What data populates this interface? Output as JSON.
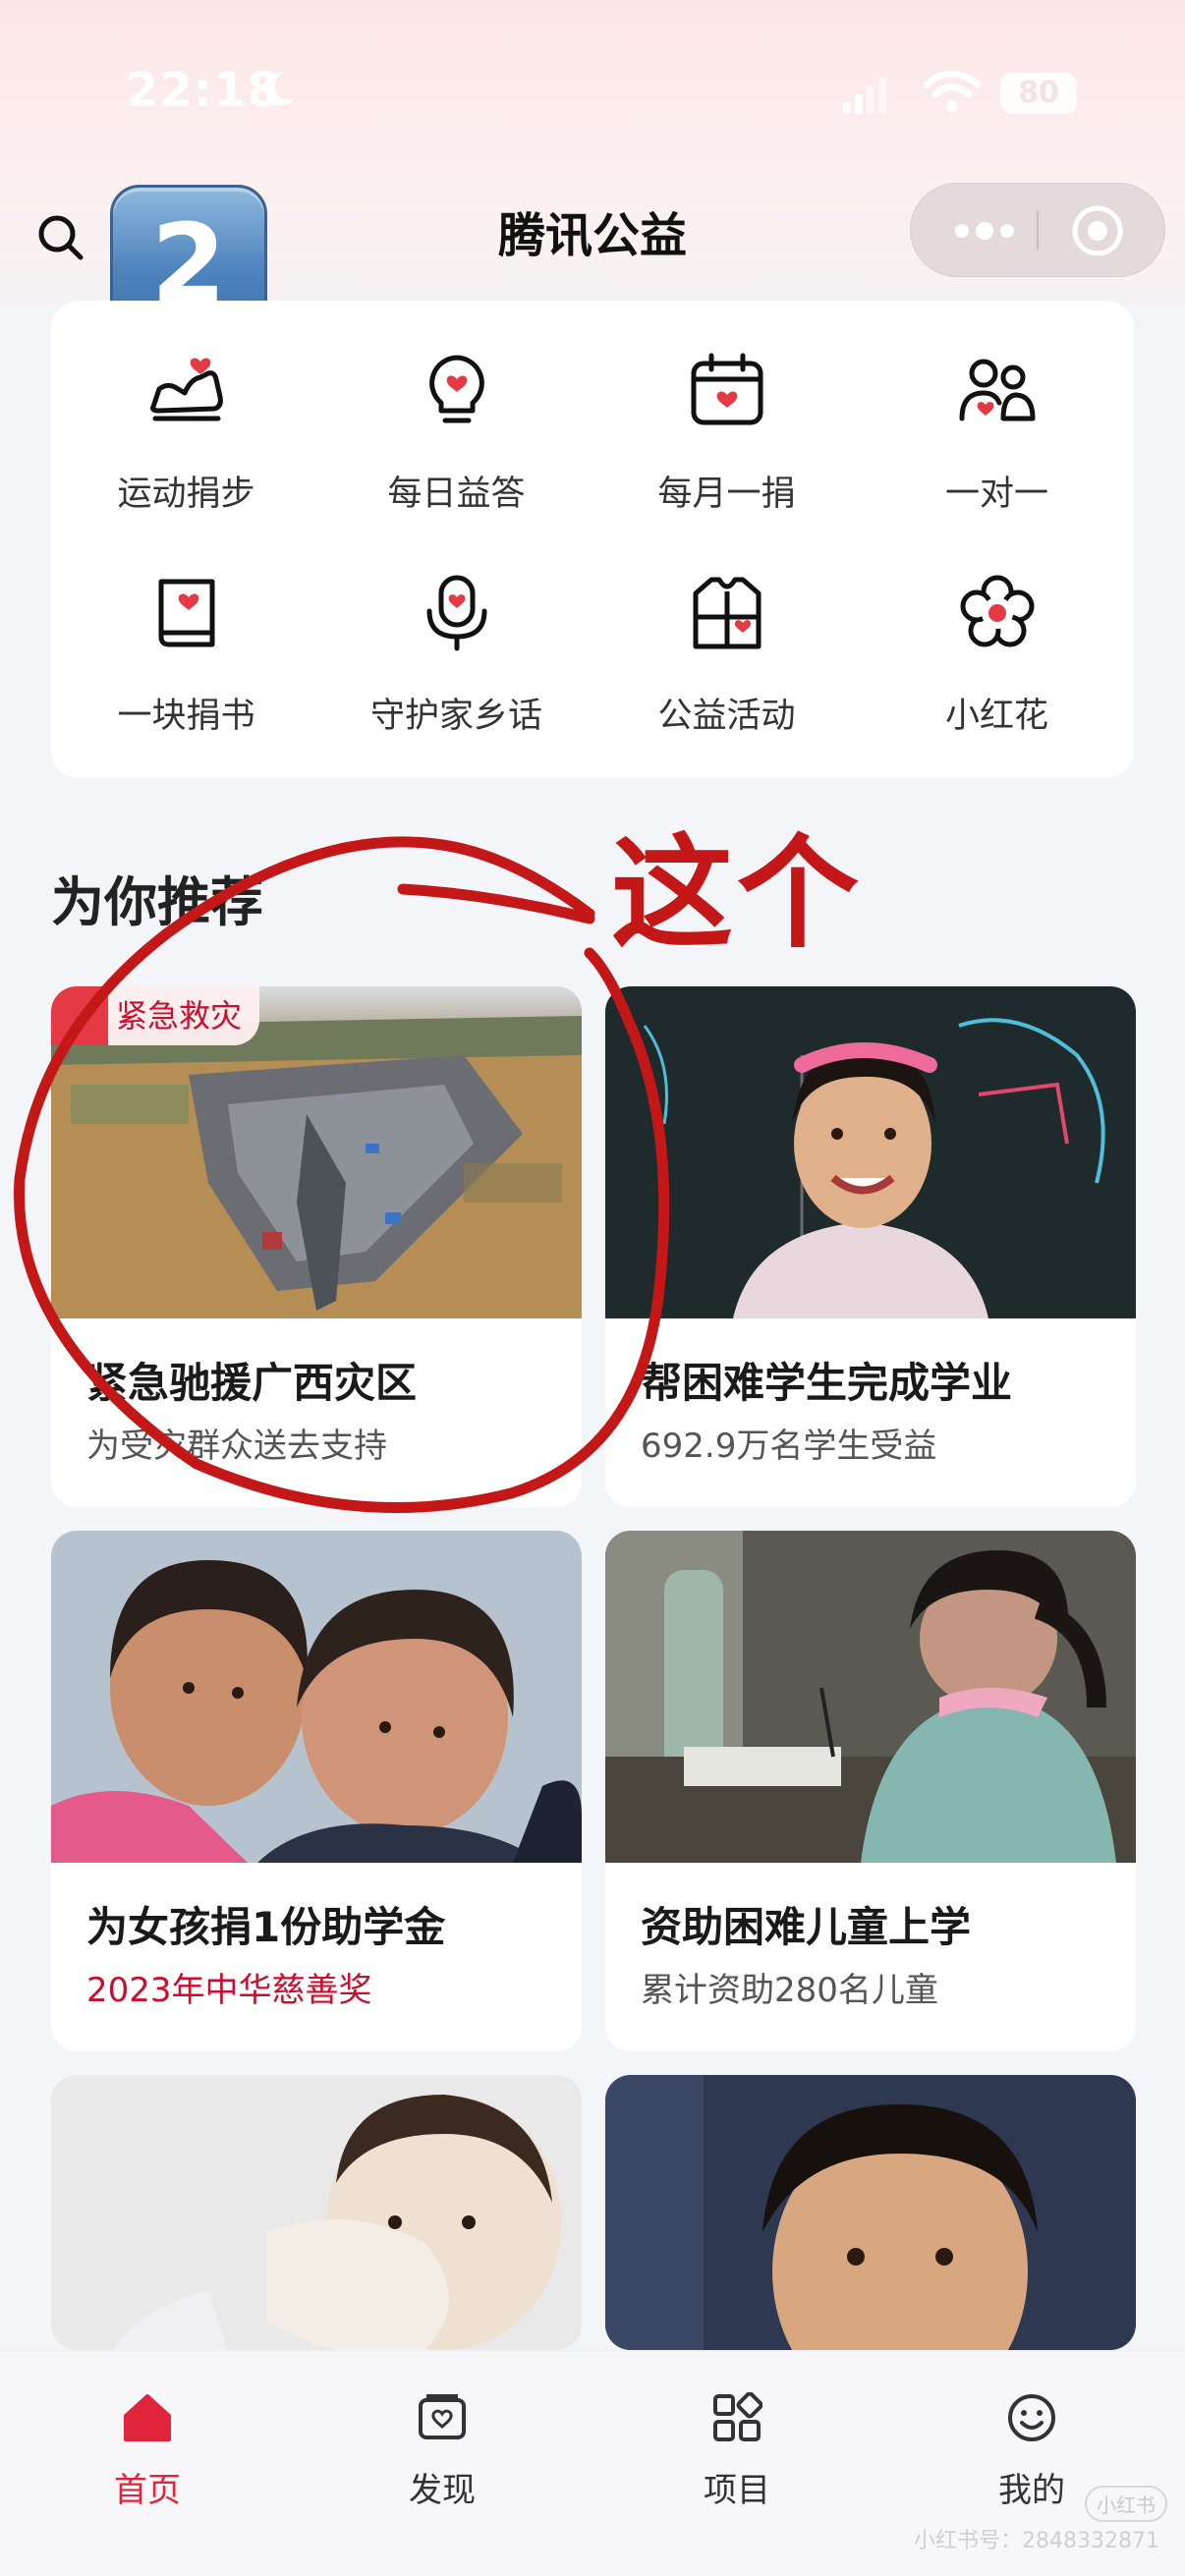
{
  "status_bar": {
    "time": "22:18",
    "battery": "80"
  },
  "nav": {
    "title": "腾讯公益",
    "step_badge": "2"
  },
  "quick_entries": [
    {
      "label": "运动捐步",
      "icon": "sneaker-heart-icon"
    },
    {
      "label": "每日益答",
      "icon": "lightbulb-heart-icon"
    },
    {
      "label": "每月一捐",
      "icon": "calendar-heart-icon"
    },
    {
      "label": "一对一",
      "icon": "people-heart-icon"
    },
    {
      "label": "一块捐书",
      "icon": "book-heart-icon"
    },
    {
      "label": "守护家乡话",
      "icon": "microphone-heart-icon"
    },
    {
      "label": "公益活动",
      "icon": "vest-heart-icon"
    },
    {
      "label": "小红花",
      "icon": "flower-icon"
    }
  ],
  "section": {
    "title": "为你推荐",
    "annotation": "这个"
  },
  "cards": [
    {
      "title": "紧急驰援广西灾区",
      "subtitle": "为受灾群众送去支持",
      "tag": "紧急救灾"
    },
    {
      "title": "帮困难学生完成学业",
      "subtitle": "692.9万名学生受益"
    },
    {
      "title": "为女孩捐1份助学金",
      "subtitle": "2023年中华慈善奖"
    },
    {
      "title": "资助困难儿童上学",
      "subtitle": "累计资助280名儿童"
    },
    {
      "title": "",
      "subtitle": ""
    },
    {
      "title": "",
      "subtitle": ""
    }
  ],
  "tabbar": [
    {
      "label": "首页",
      "icon": "home-icon",
      "active": true
    },
    {
      "label": "发现",
      "icon": "discover-icon",
      "active": false
    },
    {
      "label": "项目",
      "icon": "grid-icon",
      "active": false
    },
    {
      "label": "我的",
      "icon": "smiley-icon",
      "active": false
    }
  ],
  "watermark": "小红书号：2848332871",
  "watermark_badge": "小红书",
  "colors": {
    "accent": "#e0243c",
    "annotation": "#c41717"
  }
}
